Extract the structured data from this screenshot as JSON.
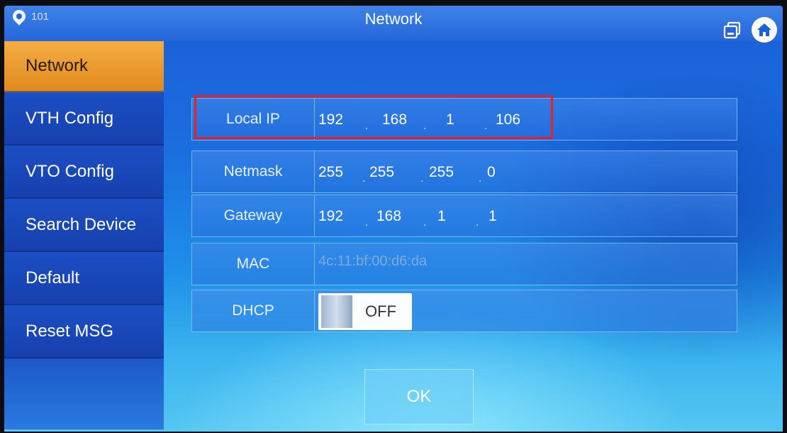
{
  "header": {
    "room_number": "101",
    "title": "Network"
  },
  "sidebar": {
    "items": [
      {
        "label": "Network",
        "active": true
      },
      {
        "label": "VTH Config"
      },
      {
        "label": "VTO Config"
      },
      {
        "label": "Search Device"
      },
      {
        "label": "Default"
      },
      {
        "label": "Reset MSG"
      }
    ]
  },
  "form": {
    "local_ip": {
      "label": "Local IP",
      "octets": [
        "192",
        "168",
        "1",
        "106"
      ]
    },
    "netmask": {
      "label": "Netmask",
      "octets": [
        "255",
        "255",
        "255",
        "0"
      ]
    },
    "gateway": {
      "label": "Gateway",
      "octets": [
        "192",
        "168",
        "1",
        "1"
      ]
    },
    "mac": {
      "label": "MAC",
      "value": "4c:11:bf:00:d6:da"
    },
    "dhcp": {
      "label": "DHCP",
      "state": "OFF"
    }
  },
  "ok_button": {
    "label": "OK"
  },
  "colors": {
    "active_tab": "#f4ad44",
    "highlight_box": "#e8202a"
  },
  "icons": {
    "location": "location-pin-icon",
    "switch": "screen-switch-icon",
    "home": "home-icon"
  }
}
